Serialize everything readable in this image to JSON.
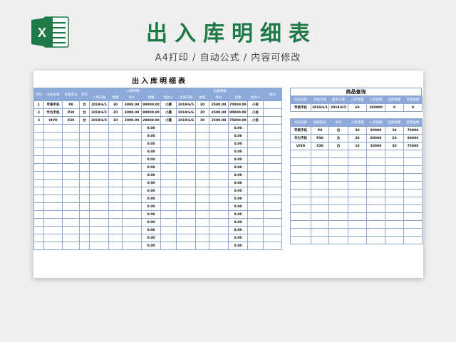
{
  "page": {
    "title": "出入库明细表",
    "subtitle": "A4打印 / 自动公式 / 内容可修改",
    "logo_icon": "excel-logo-icon",
    "accent_color": "#1d7a46",
    "header_color": "#8eaadb"
  },
  "sheet": {
    "title": "出入库明细表",
    "headers": {
      "seq": "序号",
      "name": "商品名称",
      "model": "规格型号",
      "unit": "单位",
      "in_group": "入库明细",
      "out_group": "出库明细",
      "note": "备注",
      "in_sub": [
        "入库日期",
        "数量",
        "单价",
        "金额",
        "经办人"
      ],
      "out_sub": [
        "出库日期",
        "数量",
        "单价",
        "金额",
        "经办人"
      ]
    },
    "rows": [
      {
        "seq": "1",
        "name": "苹果手机",
        "model": "P8",
        "unit": "台",
        "in_date": "2019/6/1",
        "in_qty": "30",
        "in_price": "3000.00",
        "in_amount": "90000.00",
        "in_handler": "小薇",
        "out_date": "2019/6/5",
        "out_qty": "20",
        "out_price": "3500.00",
        "out_amount": "70000.00",
        "out_handler": "小张",
        "note": ""
      },
      {
        "seq": "2",
        "name": "华为手机",
        "model": "P30",
        "unit": "台",
        "in_date": "2019/6/2",
        "in_qty": "20",
        "in_price": "4000.00",
        "in_amount": "80000.00",
        "in_handler": "小薇",
        "out_date": "2019/6/6",
        "out_qty": "20",
        "out_price": "4500.00",
        "out_amount": "90000.00",
        "out_handler": "小张",
        "note": ""
      },
      {
        "seq": "3",
        "name": "VIVO",
        "model": "X30",
        "unit": "台",
        "in_date": "2019/6/3",
        "in_qty": "10",
        "in_price": "2000.00",
        "in_amount": "20000.00",
        "in_handler": "小薇",
        "out_date": "2019/6/6",
        "out_qty": "30",
        "out_price": "2500.00",
        "out_amount": "75000.00",
        "out_handler": "小张",
        "note": ""
      }
    ],
    "empty_amount": "0.00"
  },
  "query": {
    "title": "商品查询",
    "headers": [
      "商品名称",
      "开始日期",
      "结束日期",
      "入库数量",
      "入库金额",
      "出库数量",
      "出库金额"
    ],
    "row": [
      "苹果手机",
      "2019/6/1",
      "2019/6/5",
      "60",
      "190000",
      "0",
      "0"
    ]
  },
  "summary": {
    "headers": [
      "商品名称",
      "规格型号",
      "单位",
      "入库数量",
      "入库金额",
      "出库数量",
      "出库金额"
    ],
    "rows": [
      [
        "苹果手机",
        "P8",
        "台",
        "30",
        "90000",
        "20",
        "70000"
      ],
      [
        "华为手机",
        "P30",
        "台",
        "20",
        "80000",
        "20",
        "90000"
      ],
      [
        "VIVO",
        "X30",
        "台",
        "10",
        "20000",
        "30",
        "75000"
      ]
    ]
  }
}
